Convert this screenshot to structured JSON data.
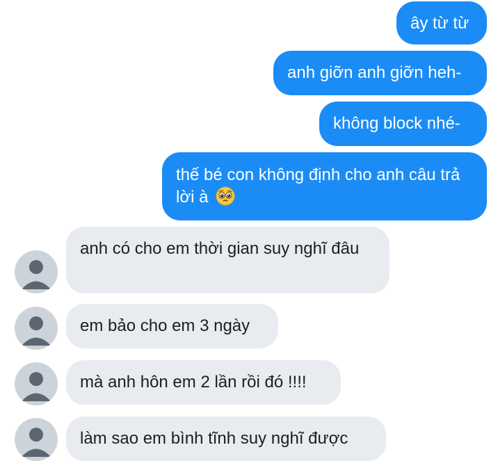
{
  "chat": {
    "outgoing": [
      {
        "text": "ây từ từ"
      },
      {
        "text": "anh giỡn anh giỡn heh-"
      },
      {
        "text": "không block nhé-"
      },
      {
        "text": "thế bé con không định cho anh câu trả lời à",
        "emoji": "pleading-face-emoji"
      }
    ],
    "incoming": [
      {
        "text": "anh có cho em thời gian suy nghĩ đâu"
      },
      {
        "text": "em bảo cho em 3 ngày"
      },
      {
        "text": "mà anh hôn em 2 lần rồi đó !!!!"
      },
      {
        "text": "làm sao em bình tĩnh suy nghĩ được"
      }
    ]
  },
  "colors": {
    "outgoing_bubble": "#1b8cf5",
    "incoming_bubble": "#e8ebf0",
    "avatar_bg": "#cdd3da",
    "avatar_figure": "#5b6670"
  },
  "icons": {
    "avatar": "default-user-avatar-icon",
    "emoji": "pleading-face-emoji"
  }
}
